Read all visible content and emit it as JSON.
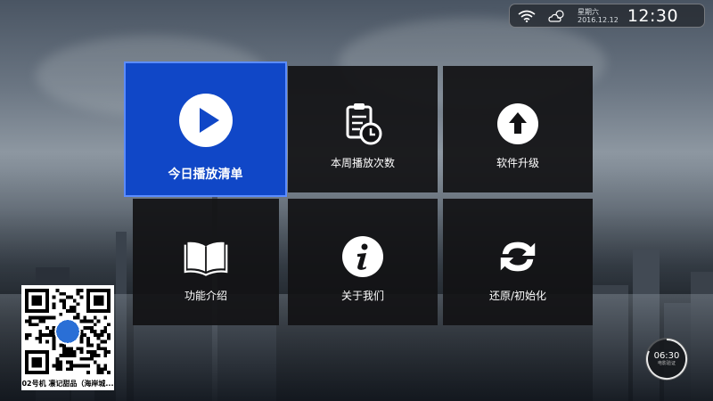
{
  "status_bar": {
    "wifi_icon": "wifi-icon",
    "weather_icon": "cloud-sun-icon",
    "weekday": "星期六",
    "date": "2016.12.12",
    "time": "12:30"
  },
  "tiles": [
    {
      "label": "今日播放清单",
      "icon": "play-circle-icon",
      "selected": true
    },
    {
      "label": "本周播放次数",
      "icon": "clipboard-clock-icon",
      "selected": false
    },
    {
      "label": "软件升级",
      "icon": "upload-arrow-icon",
      "selected": false
    },
    {
      "label": "功能介绍",
      "icon": "open-book-icon",
      "selected": false
    },
    {
      "label": "关于我们",
      "icon": "info-icon",
      "selected": false
    },
    {
      "label": "还原/初始化",
      "icon": "refresh-icon",
      "selected": false
    }
  ],
  "qr": {
    "caption": "02号机 凛记甜品（海岸城..."
  },
  "clock_widget": {
    "time": "06:30",
    "label": "电影验证"
  },
  "colors": {
    "selected_tile": "#1047c7",
    "tile": "#121214"
  }
}
